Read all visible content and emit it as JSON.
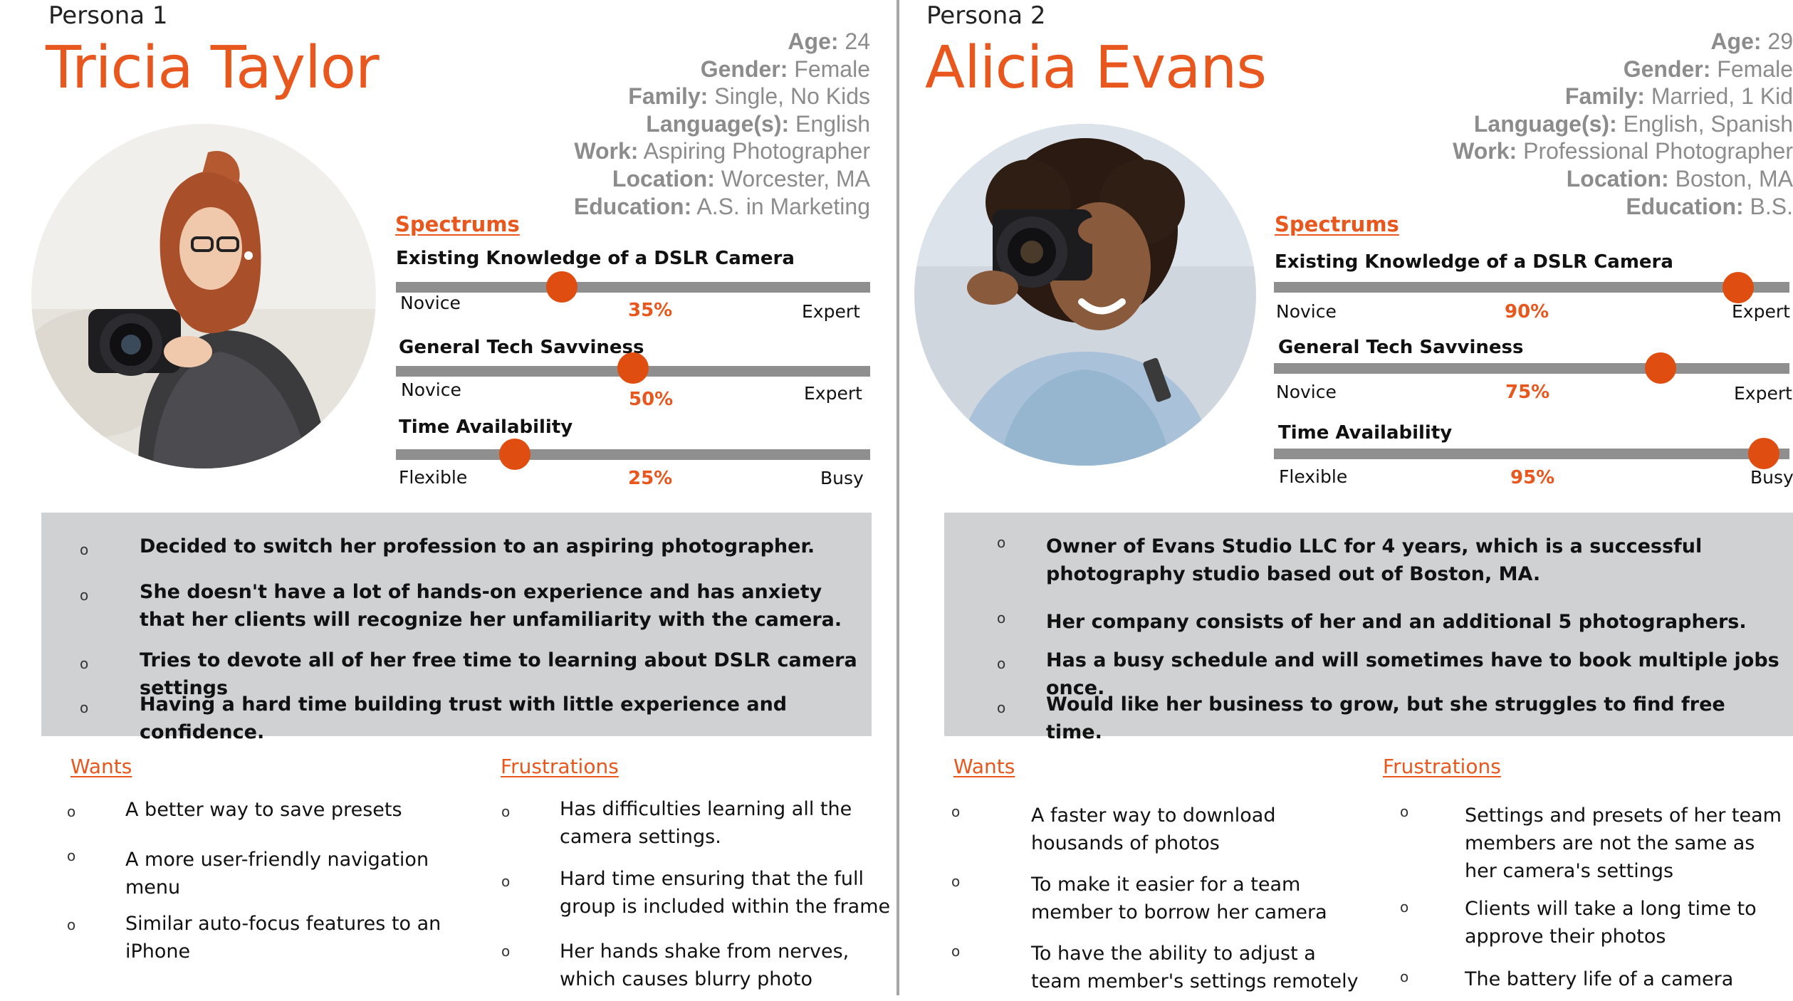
{
  "personas": [
    {
      "label": "Persona 1",
      "name": "Tricia Taylor",
      "attributes": [
        {
          "key": "Age:",
          "value": " 24"
        },
        {
          "key": "Gender:",
          "value": " Female"
        },
        {
          "key": "Family:",
          "value": " Single, No Kids"
        },
        {
          "key": "Language(s):",
          "value": " English"
        },
        {
          "key": "Work:",
          "value": " Aspiring Photographer"
        },
        {
          "key": "Location:",
          "value": " Worcester, MA"
        },
        {
          "key": "Education:",
          "value": " A.S. in Marketing"
        }
      ],
      "spectrums_title": "Spectrums",
      "spectrums": [
        {
          "label": "Existing Knowledge of a DSLR Camera",
          "left": "Novice",
          "right": "Expert",
          "percent_label": "35%",
          "value": 0.35
        },
        {
          "label": "General Tech Savviness",
          "left": "Novice",
          "right": "Expert",
          "percent_label": "50%",
          "value": 0.5
        },
        {
          "label": "Time Availability",
          "left": "Flexible",
          "right": "Busy",
          "percent_label": "25%",
          "value": 0.25
        }
      ],
      "bio": [
        "Decided to switch her profession to an aspiring photographer.",
        "She doesn't have a lot of hands-on experience and has anxiety that her clients will recognize her unfamiliarity with the camera.",
        "Tries to devote all of her free time to learning about DSLR camera settings",
        "Having a hard time building trust with little experience and confidence."
      ],
      "wants_title": "Wants",
      "wants": [
        "A better way to save presets",
        "A more user-friendly navigation menu",
        "Similar auto-focus features to an iPhone"
      ],
      "frustrations_title": "Frustrations",
      "frustrations": [
        "Has difficulties learning all the camera settings.",
        "Hard time ensuring that the full group is included within the frame",
        "Her hands shake from nerves, which causes blurry photo"
      ]
    },
    {
      "label": "Persona 2",
      "name": "Alicia Evans",
      "attributes": [
        {
          "key": "Age:",
          "value": " 29"
        },
        {
          "key": "Gender:",
          "value": " Female"
        },
        {
          "key": "Family:",
          "value": " Married, 1 Kid"
        },
        {
          "key": "Language(s):",
          "value": " English, Spanish"
        },
        {
          "key": "Work:",
          "value": " Professional Photographer"
        },
        {
          "key": "Location:",
          "value": " Boston, MA"
        },
        {
          "key": "Education:",
          "value": " B.S."
        }
      ],
      "spectrums_title": "Spectrums",
      "spectrums": [
        {
          "label": "Existing Knowledge of a DSLR Camera",
          "left": "Novice",
          "right": "Expert",
          "percent_label": "90%",
          "value": 0.9
        },
        {
          "label": "General Tech Savviness",
          "left": "Novice",
          "right": "Expert",
          "percent_label": "75%",
          "value": 0.75
        },
        {
          "label": "Time Availability",
          "left": "Flexible",
          "right": "Busy",
          "percent_label": "95%",
          "value": 0.95
        }
      ],
      "bio": [
        "Owner of Evans Studio LLC for 4 years, which is a successful photography studio based out of Boston, MA.",
        "Her company consists of her and an additional 5 photographers.",
        "Has a busy schedule and will sometimes have to book multiple jobs once.",
        "Would like her business to grow, but she struggles to find free time."
      ],
      "wants_title": "Wants",
      "wants": [
        "A faster way to download housands of photos",
        "To make it easier for a team member to borrow her camera",
        "To have the ability to adjust a team member's settings remotely"
      ],
      "frustrations_title": "Frustrations",
      "frustrations": [
        "Settings and presets of her team members are not the same as her camera's settings",
        "Clients will take a long time to approve their photos",
        "The battery life of a camera"
      ]
    }
  ],
  "colors": {
    "accent": "#e8571d",
    "knob": "#e04d10",
    "track": "#8f8f8f",
    "panel": "#d0d1d3",
    "attr_text": "#8c8c8c"
  },
  "bullet_glyph": "o"
}
